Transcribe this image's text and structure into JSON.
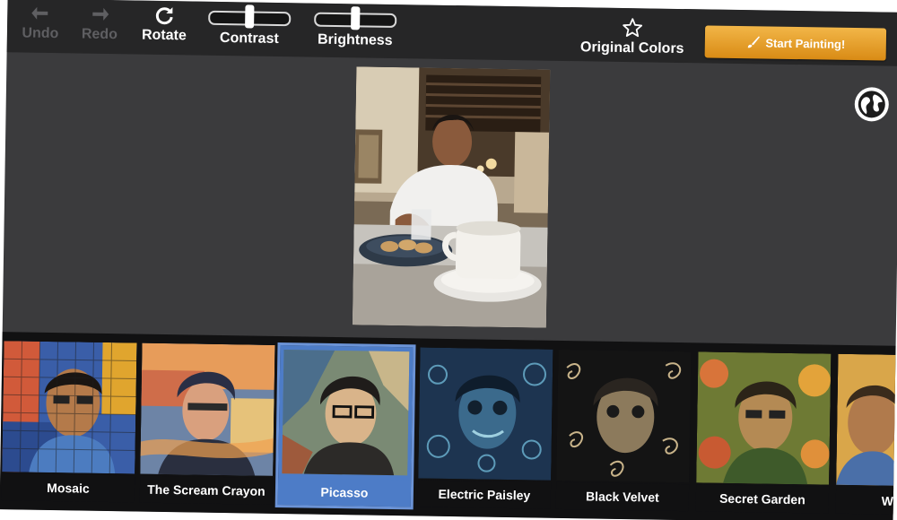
{
  "toolbar": {
    "undo_label": "Undo",
    "redo_label": "Redo",
    "rotate_label": "Rotate",
    "contrast_label": "Contrast",
    "brightness_label": "Brightness",
    "original_colors_label": "Original Colors",
    "start_painting_label": "Start Painting!"
  },
  "contrast_level": 0.5,
  "brightness_level": 0.5,
  "styles": [
    {
      "name": "Mosaic",
      "selected": false
    },
    {
      "name": "The Scream Crayon",
      "selected": false
    },
    {
      "name": "Picasso",
      "selected": true
    },
    {
      "name": "Electric Paisley",
      "selected": false
    },
    {
      "name": "Black Velvet",
      "selected": false
    },
    {
      "name": "Secret Garden",
      "selected": false
    },
    {
      "name": "Waterc",
      "selected": false
    }
  ],
  "colors": {
    "accent": "#e69f27",
    "selection": "#4d7cc7",
    "toolbar_bg": "#262627",
    "canvas_bg": "#3b3b3d"
  },
  "icons": [
    "undo-arrow-icon",
    "redo-arrow-icon",
    "rotate-icon",
    "star-icon",
    "brush-icon",
    "globe-icon"
  ]
}
